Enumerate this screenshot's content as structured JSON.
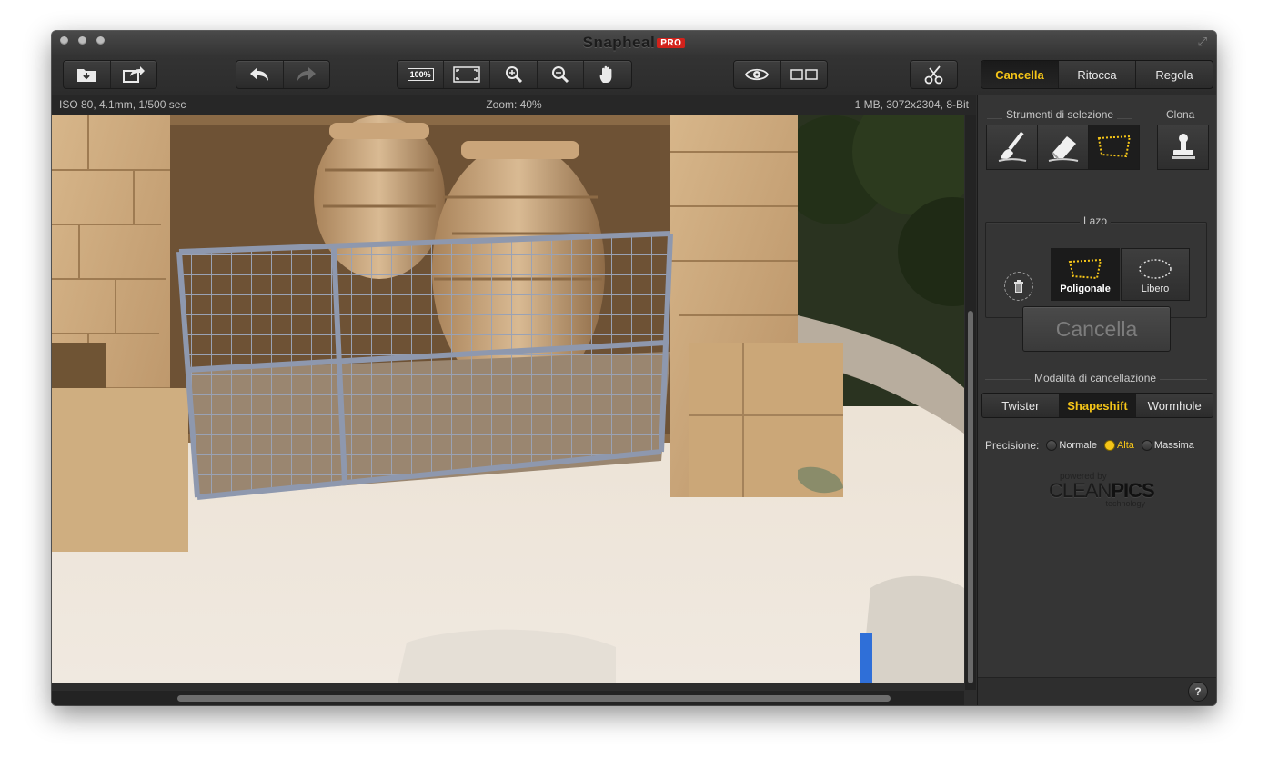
{
  "window": {
    "title": "Snapheal",
    "badge": "PRO",
    "fullscreen_icon": "⤢"
  },
  "toolbar": {
    "icons": [
      "import-icon",
      "share-icon",
      "undo-icon",
      "redo-icon",
      "zoom-100-icon",
      "fit-screen-icon",
      "zoom-in-icon",
      "zoom-out-icon",
      "hand-icon",
      "eye-icon",
      "compare-icon",
      "crop-icon"
    ],
    "zoom_100_label": "100%"
  },
  "modes": {
    "tabs": [
      {
        "label": "Cancella",
        "active": true
      },
      {
        "label": "Ritocca",
        "active": false
      },
      {
        "label": "Regola",
        "active": false
      }
    ],
    "accent": "#f5c518"
  },
  "info": {
    "exif": "ISO 80, 4.1mm, 1/500 sec",
    "zoom": "Zoom: 40%",
    "file": "1 MB, 3072x2304, 8-Bit"
  },
  "panel": {
    "selection_tools_label": "Strumenti di selezione",
    "clone_label": "Clona",
    "selection_tools": [
      "brush-icon",
      "eraser-icon",
      "lasso-icon"
    ],
    "lasso_label": "Lazo",
    "lasso_options": [
      {
        "label": "Poligonale",
        "active": true
      },
      {
        "label": "Libero",
        "active": false
      }
    ],
    "erase_button": "Cancella",
    "erase_mode_label": "Modalità di cancellazione",
    "erase_modes": [
      {
        "label": "Twister",
        "active": false
      },
      {
        "label": "Shapeshift",
        "active": true
      },
      {
        "label": "Wormhole",
        "active": false
      }
    ],
    "precision_label": "Precisione:",
    "precision_options": [
      {
        "label": "Normale",
        "selected": false
      },
      {
        "label": "Alta",
        "selected": true
      },
      {
        "label": "Massima",
        "selected": false
      }
    ],
    "powered_by": "powered by",
    "brand_light": "CLEAN",
    "brand_bold": "PICS",
    "brand_sub": "technology",
    "help": "?"
  }
}
